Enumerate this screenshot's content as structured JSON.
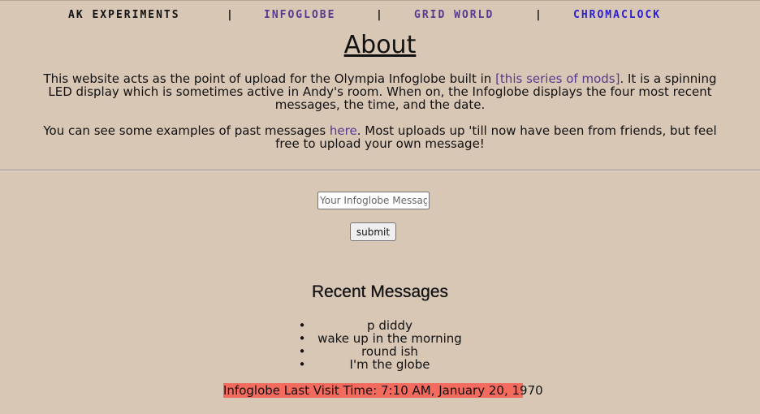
{
  "nav": {
    "home": "AK EXPERIMENTS",
    "separator": "|",
    "links": [
      "INFOGLOBE",
      "GRID WORLD",
      "CHROMACLOCK"
    ]
  },
  "about": {
    "title": "About",
    "p1_before": "This website acts as the point of upload for the Olympia Infoglobe built in ",
    "p1_link": "[this series of mods]",
    "p1_after": ". It is a spinning LED display which is sometimes active in Andy's room. When on, the Infoglobe displays the four most recent messages, the time, and the date.",
    "p2_before": "You can see some examples of past messages ",
    "p2_link": "here",
    "p2_after": ". Most uploads up 'till now have been from friends, but feel free to upload your own message!"
  },
  "form": {
    "input_placeholder": "Your Infoglobe Message",
    "input_value": "",
    "submit_label": "submit"
  },
  "recent": {
    "title": "Recent Messages",
    "bullet": "•",
    "messages": [
      "p diddy",
      "wake up in the morning",
      "round ish",
      "I'm the globe"
    ]
  },
  "last_visit": "Infoglobe Last Visit Time: 7:10 AM, January 20, 1970",
  "colors": {
    "background": "#d9c7b6",
    "link": "#553a8e",
    "chromaclock_link": "#2a1fcf",
    "last_visit_bg": "#f36a5e"
  }
}
